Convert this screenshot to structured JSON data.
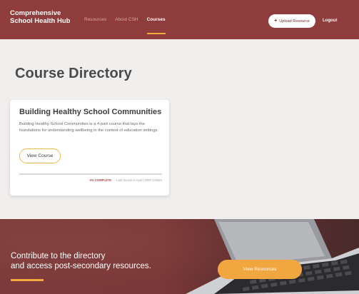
{
  "header": {
    "brand": "Comprehensive School Health Hub",
    "nav": [
      "Resources",
      "About CSH",
      "Courses"
    ],
    "upload_label": "Upload Resource",
    "logout_label": "Logout",
    "accent": "#f0a93a",
    "header_color": "#8f3c3c"
  },
  "main": {
    "page_title": "Course Directory",
    "course": {
      "title": "Building Healthy School Communities",
      "description": "Building Healthy School Communities is a 4-part course that lays the foundations for understanding wellbeing in the context of education settings.",
      "button_label": "View Course",
      "status": "0% COMPLETE",
      "last_accessed": "Last access in April | 2020 1:04am",
      "progress": 0
    }
  },
  "banner": {
    "line1": "Contribute to the directory",
    "line2": "and access post-secondary resources.",
    "button_label": "View Resources"
  }
}
